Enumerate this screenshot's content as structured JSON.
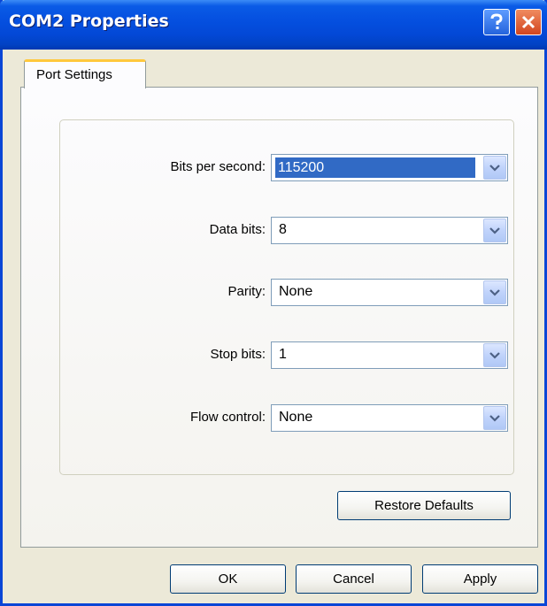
{
  "window": {
    "title": "COM2 Properties",
    "help_icon": "question-mark-icon",
    "close_icon": "close-x-icon"
  },
  "tabs": [
    {
      "label": "Port Settings",
      "active": true
    }
  ],
  "settings": [
    {
      "label": "Bits per second:",
      "value": "115200",
      "selected": true
    },
    {
      "label": "Data bits:",
      "value": "8",
      "selected": false
    },
    {
      "label": "Parity:",
      "value": "None",
      "selected": false
    },
    {
      "label": "Stop bits:",
      "value": "1",
      "selected": false
    },
    {
      "label": "Flow control:",
      "value": "None",
      "selected": false
    }
  ],
  "buttons": {
    "restore_defaults": "Restore Defaults",
    "ok": "OK",
    "cancel": "Cancel",
    "apply": "Apply"
  },
  "colors": {
    "titlebar": "#0550e0",
    "selection": "#316ac5",
    "tab_highlight": "#ffc83c"
  }
}
